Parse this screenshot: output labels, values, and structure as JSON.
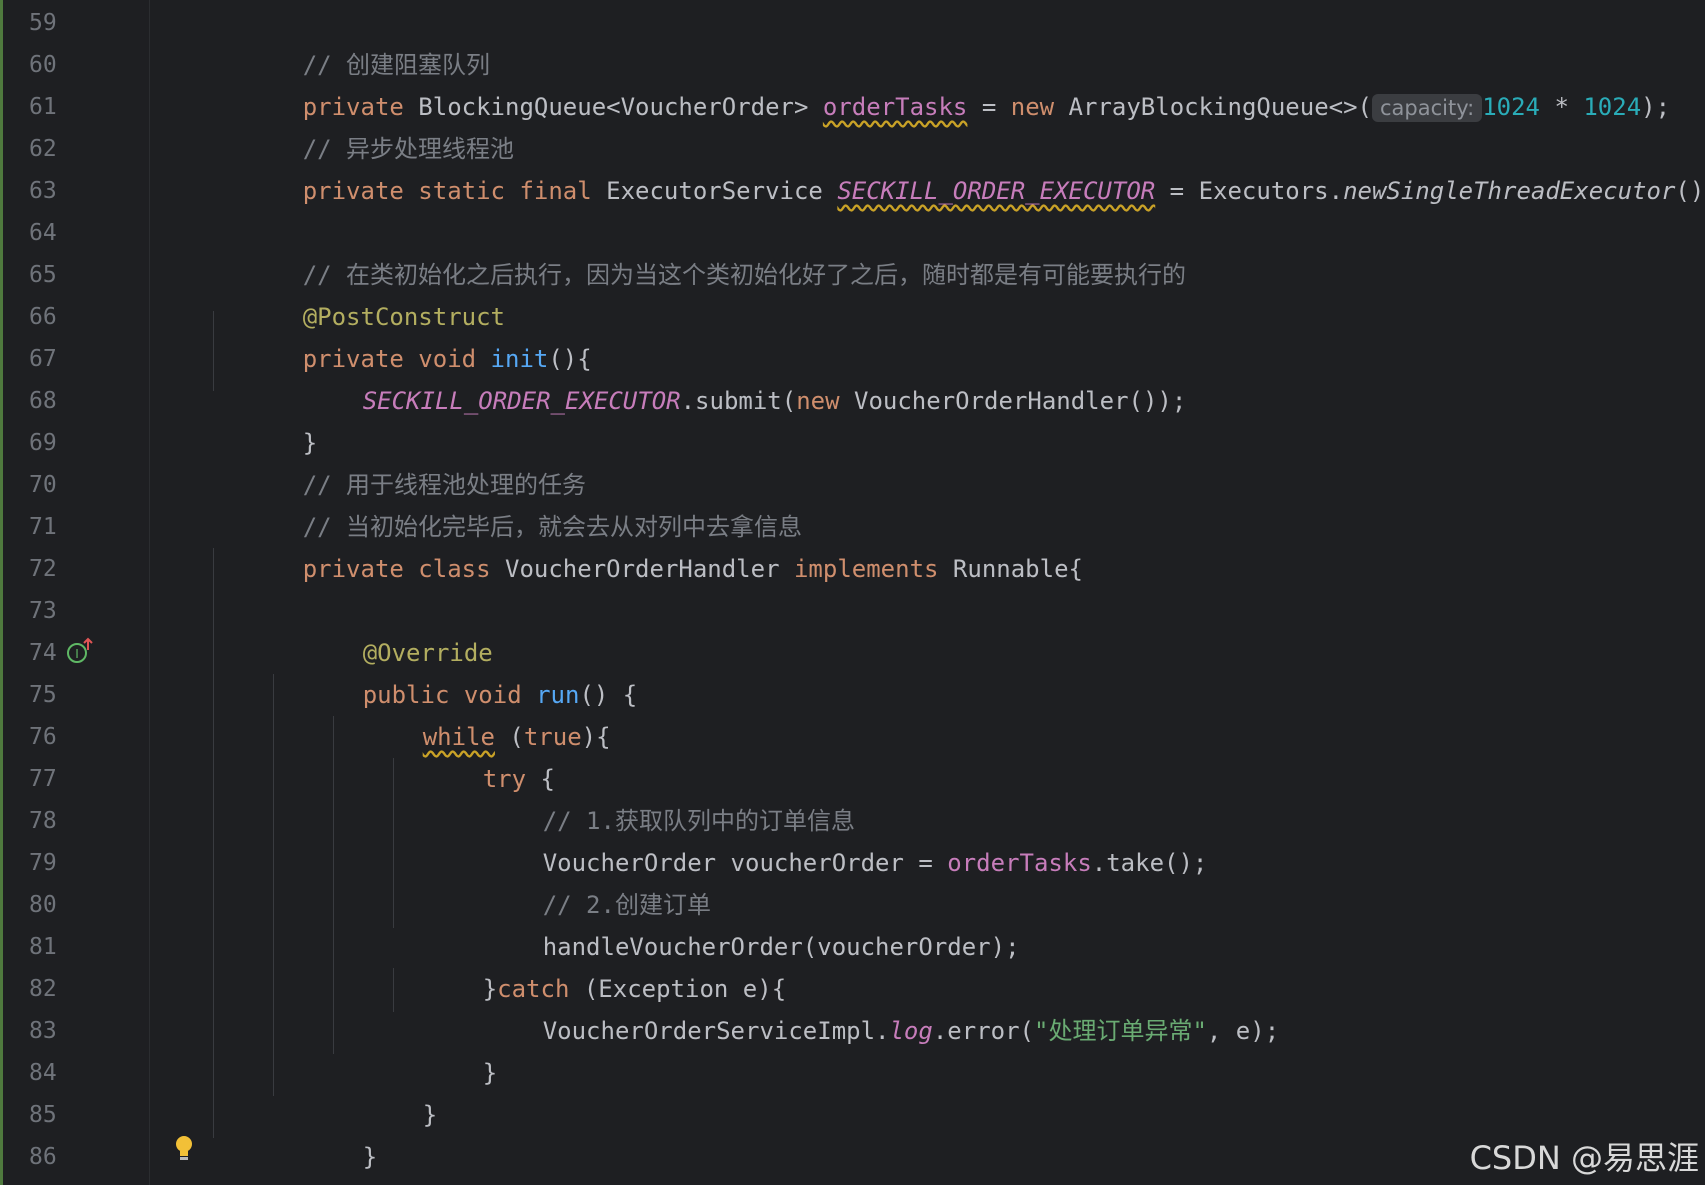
{
  "gutter": {
    "line_numbers": [
      "59",
      "60",
      "61",
      "62",
      "63",
      "64",
      "65",
      "66",
      "67",
      "68",
      "69",
      "70",
      "71",
      "72",
      "73",
      "74",
      "75",
      "76",
      "77",
      "78",
      "79",
      "80",
      "81",
      "82",
      "83",
      "84",
      "85",
      "86"
    ],
    "implements_icon": "override-implements-icon",
    "bulb_icon": "lightbulb-icon"
  },
  "code": {
    "l59": {
      "comment": "// 创建阻塞队列"
    },
    "l60": {
      "kw_private": "private",
      "type": " BlockingQueue<VoucherOrder> ",
      "field": "orderTasks",
      "eq": " = ",
      "kw_new": "new",
      "ctor": " ArrayBlockingQueue<>(",
      "hint": "capacity:",
      "n1": "1024",
      "op": " * ",
      "n2": "1024",
      "end": ");"
    },
    "l61": {
      "comment": "// 异步处理线程池"
    },
    "l62": {
      "kw": "private static final",
      "type": " ExecutorService ",
      "const": "SECKILL_ORDER_EXECUTOR",
      "eq": " = Executors.",
      "method": "newSingleThreadExecutor",
      "end": "();"
    },
    "l64": {
      "comment": "// 在类初始化之后执行，因为当这个类初始化好了之后，随时都是有可能要执行的"
    },
    "l65": {
      "annotation": "@PostConstruct"
    },
    "l66": {
      "kw": "private void ",
      "name": "init",
      "end": "(){"
    },
    "l67": {
      "const": "SECKILL_ORDER_EXECUTOR",
      "call": ".submit(",
      "kw_new": "new",
      "rest": " VoucherOrderHandler());"
    },
    "l68": {
      "text": "}"
    },
    "l69": {
      "comment": "// 用于线程池处理的任务"
    },
    "l70": {
      "comment": "// 当初始化完毕后，就会去从对列中去拿信息"
    },
    "l71": {
      "kw": "private class",
      "name": " VoucherOrderHandler ",
      "kw2": "implements",
      "rest": " Runnable{"
    },
    "l73": {
      "annotation": "@Override"
    },
    "l74": {
      "kw": "public void ",
      "name": "run",
      "end": "() {"
    },
    "l75": {
      "kw_while": "while",
      "paren_open": " (",
      "kw_true": "true",
      "end": "){"
    },
    "l76": {
      "kw": "try",
      "end": " {"
    },
    "l77": {
      "comment": "// 1.获取队列中的订单信息"
    },
    "l78": {
      "pre": "VoucherOrder voucherOrder = ",
      "field": "orderTasks",
      "end": ".take();"
    },
    "l79": {
      "comment": "// 2.创建订单"
    },
    "l80": {
      "text": "handleVoucherOrder(voucherOrder);"
    },
    "l81": {
      "brace": "}",
      "kw": "catch",
      "rest": " (Exception e){"
    },
    "l82": {
      "pre": "VoucherOrderServiceImpl.",
      "log": "log",
      "mid": ".error(",
      "str": "\"处理订单异常\"",
      "end": ", e);"
    },
    "l83": {
      "text": "}"
    },
    "l84": {
      "text": "}"
    },
    "l85": {
      "text": "}"
    },
    "l86": {
      "text": "}"
    }
  },
  "watermark": "CSDN @易思涯"
}
